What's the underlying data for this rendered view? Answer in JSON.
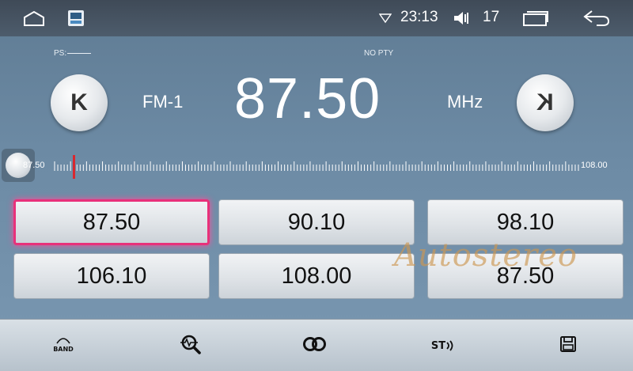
{
  "status_bar": {
    "time": "23:13",
    "volume_level": "17",
    "icons": [
      "home-icon",
      "app-icon",
      "wifi-icon",
      "volume-icon",
      "recent-apps-icon",
      "back-icon"
    ]
  },
  "radio": {
    "ps_label": "PS:",
    "pty_label": "NO PTY",
    "band": "FM-1",
    "frequency": "87.50",
    "unit": "MHz",
    "prev_label": "K",
    "next_label": "K",
    "scale": {
      "min_label": "87.50",
      "max_label": "108.00",
      "min": 87.5,
      "max": 108.0,
      "current": 87.5
    }
  },
  "presets": [
    {
      "label": "87.50",
      "active": true
    },
    {
      "label": "90.10",
      "active": false
    },
    {
      "label": "98.10",
      "active": false
    },
    {
      "label": "106.10",
      "active": false
    },
    {
      "label": "108.00",
      "active": false
    },
    {
      "label": "87.50",
      "active": false
    }
  ],
  "watermark": "Autostereo",
  "toolbar": {
    "band_label": "BAND",
    "stereo_label": "ST",
    "icons": [
      "band-icon",
      "search-icon",
      "loud-icon",
      "stereo-icon",
      "save-icon"
    ]
  },
  "colors": {
    "accent_active": "#e8317a",
    "marker": "#d9282f",
    "background": "#6c8aa4"
  }
}
